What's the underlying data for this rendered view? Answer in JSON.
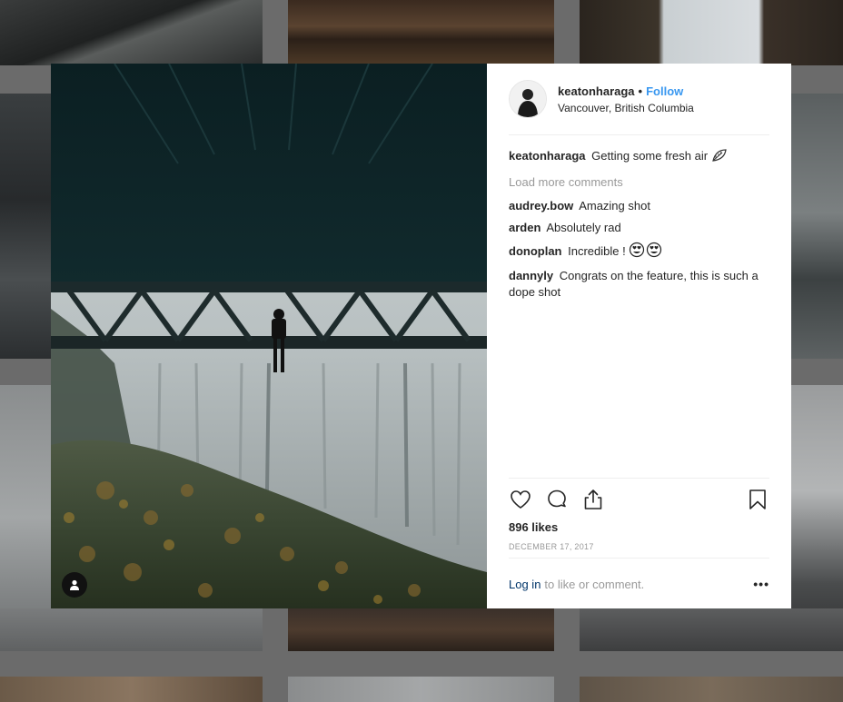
{
  "post": {
    "username": "keatonharaga",
    "separator": "•",
    "follow_label": "Follow",
    "location": "Vancouver, British Columbia",
    "caption_user": "keatonharaga",
    "caption_text": "Getting some fresh air",
    "caption_emoji_icon": "leaf-icon",
    "load_more_label": "Load more comments",
    "comments": [
      {
        "user": "audrey.bow",
        "text": "Amazing shot"
      },
      {
        "user": "arden",
        "text": "Absolutely rad"
      },
      {
        "user": "donoplan",
        "text": "Incredible !"
      },
      {
        "user": "dannyly",
        "text": "Congrats on the feature, this is such a dope shot"
      }
    ],
    "likes": "896 likes",
    "date": "DECEMBER 17, 2017",
    "login_link": "Log in",
    "login_suffix": "to like or comment.",
    "more_label": "•••"
  },
  "icons": {
    "like": "heart-icon",
    "comment": "comment-icon",
    "share": "share-icon",
    "save": "bookmark-icon",
    "user_tag": "user-icon"
  },
  "colors": {
    "link": "#3897f0",
    "login_link": "#003569",
    "muted": "#999999",
    "text": "#262626"
  }
}
